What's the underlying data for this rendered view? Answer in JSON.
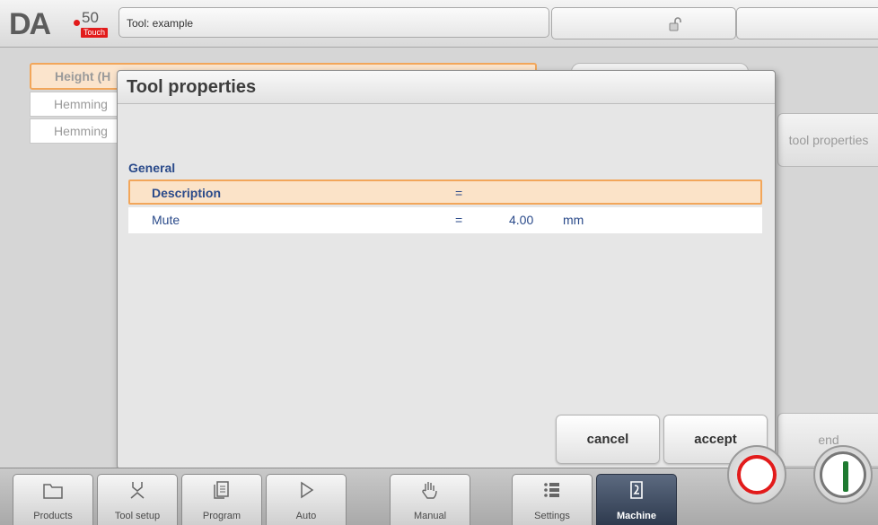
{
  "header": {
    "logo": {
      "brand": "DA",
      "model": "50",
      "edition": "Touch"
    },
    "title": "Tool: example"
  },
  "background": {
    "list_items": [
      "Height (H",
      "Hemming",
      "Hemming"
    ],
    "side_buttons": {
      "tool_properties": "tool properties",
      "end": "end"
    }
  },
  "dialog": {
    "title": "Tool properties",
    "section": "General",
    "rows": [
      {
        "label": "Description",
        "eq": "=",
        "value": "",
        "unit": ""
      },
      {
        "label": "Mute",
        "eq": "=",
        "value": "4.00",
        "unit": "mm"
      }
    ],
    "buttons": {
      "cancel": "cancel",
      "accept": "accept"
    }
  },
  "nav": [
    {
      "label": "Products",
      "icon": "folder-icon"
    },
    {
      "label": "Tool setup",
      "icon": "tool-setup-icon"
    },
    {
      "label": "Program",
      "icon": "program-icon"
    },
    {
      "label": "Auto",
      "icon": "play-icon"
    },
    {
      "label": "Manual",
      "icon": "hand-icon"
    },
    {
      "label": "Settings",
      "icon": "settings-list-icon"
    },
    {
      "label": "Machine",
      "icon": "machine-icon",
      "active": true
    }
  ],
  "colors": {
    "highlight": "#fbe3c8",
    "highlight_border": "#f2a65a",
    "label_blue": "#2a4a8a",
    "stop_red": "#e21b1b",
    "start_green": "#1e7a30"
  }
}
